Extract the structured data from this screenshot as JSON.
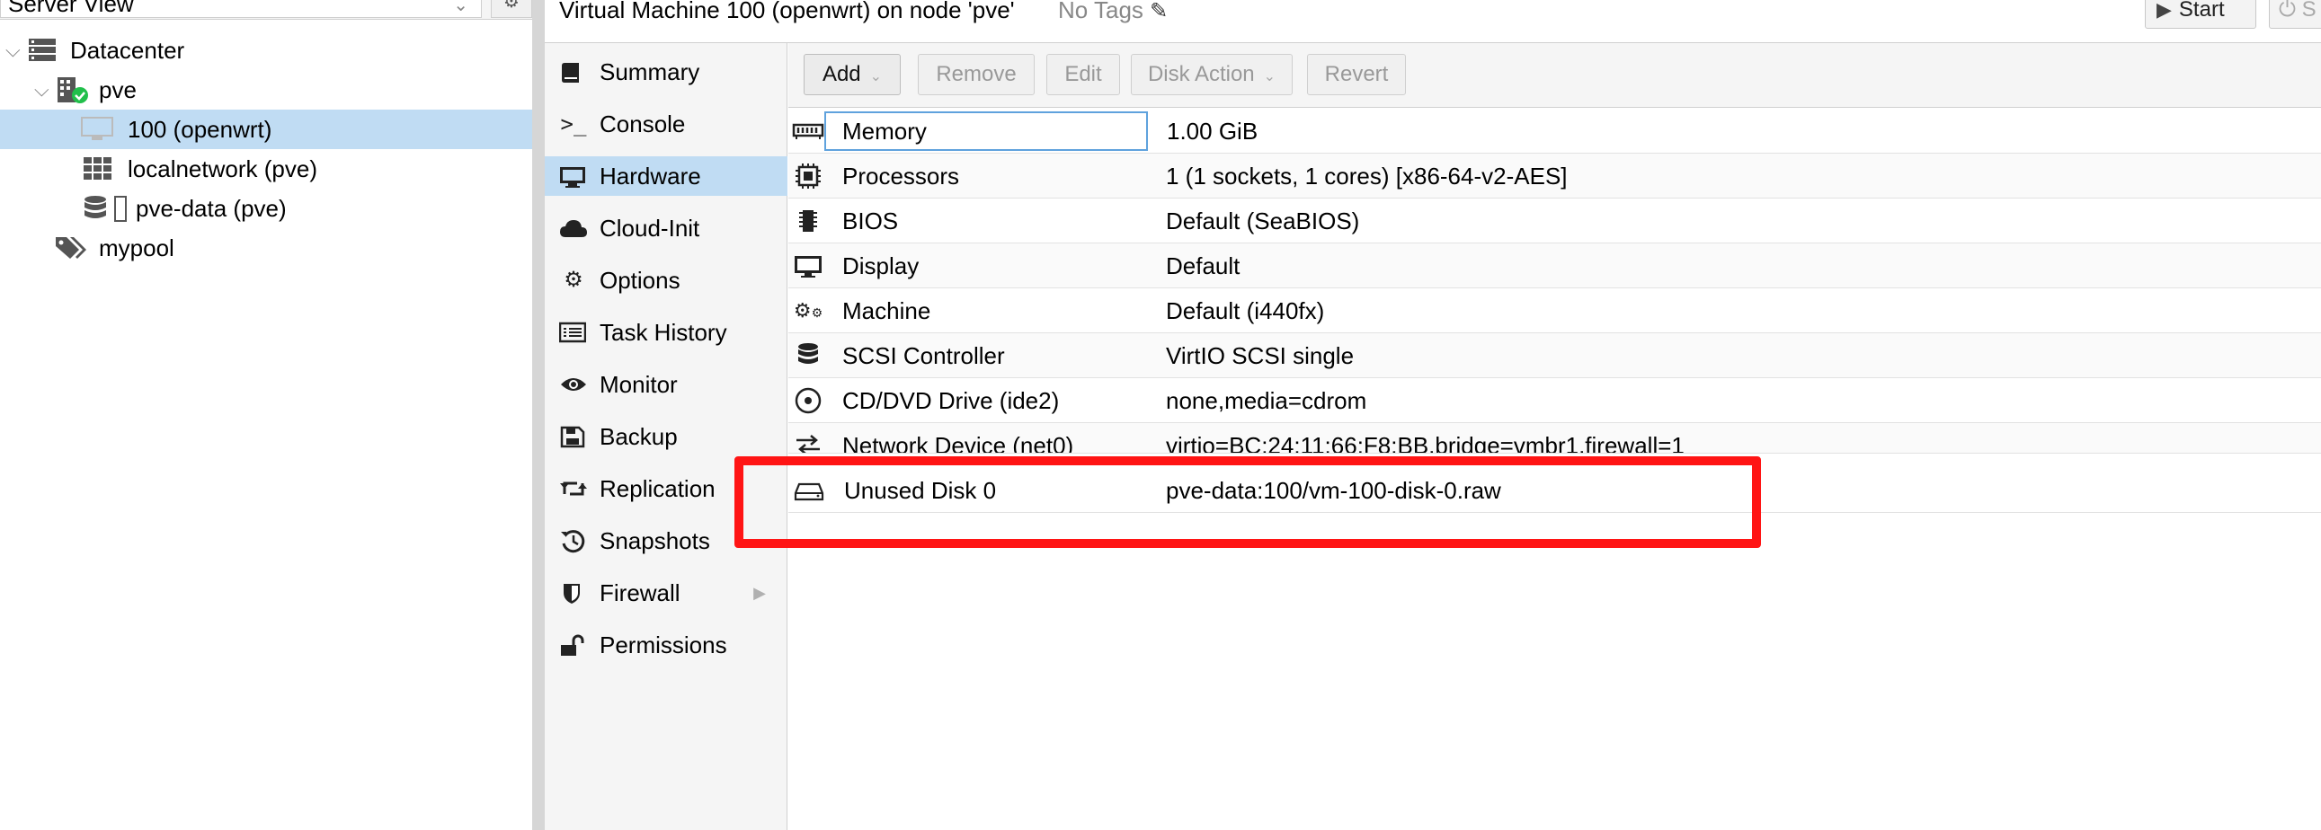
{
  "tree": {
    "view_label": "Server View",
    "items": [
      {
        "label": "Datacenter",
        "icon": "datacenter-icon"
      },
      {
        "label": "pve",
        "icon": "node-online-icon"
      },
      {
        "label": "100 (openwrt)",
        "icon": "vm-icon"
      },
      {
        "label": "localnetwork (pve)",
        "icon": "sdn-zone-icon"
      },
      {
        "label": "pve-data (pve)",
        "icon": "storage-icon"
      },
      {
        "label": "mypool",
        "icon": "pool-tags-icon"
      }
    ]
  },
  "header": {
    "title": "Virtual Machine 100 (openwrt) on node 'pve'",
    "tags": "No Tags",
    "start_label": "Start",
    "shutdown_label": "S"
  },
  "side_menu": {
    "items": [
      {
        "label": "Summary",
        "icon": "book-icon"
      },
      {
        "label": "Console",
        "icon": "terminal-icon"
      },
      {
        "label": "Hardware",
        "icon": "desktop-icon"
      },
      {
        "label": "Cloud-Init",
        "icon": "cloud-icon"
      },
      {
        "label": "Options",
        "icon": "gear-icon"
      },
      {
        "label": "Task History",
        "icon": "list-alt-icon"
      },
      {
        "label": "Monitor",
        "icon": "eye-icon"
      },
      {
        "label": "Backup",
        "icon": "floppy-icon"
      },
      {
        "label": "Replication",
        "icon": "retweet-icon"
      },
      {
        "label": "Snapshots",
        "icon": "history-icon"
      },
      {
        "label": "Firewall",
        "icon": "shield-icon"
      },
      {
        "label": "Permissions",
        "icon": "unlock-icon"
      }
    ],
    "active": "Hardware"
  },
  "toolbar": {
    "add_label": "Add",
    "remove_label": "Remove",
    "edit_label": "Edit",
    "disk_action_label": "Disk Action",
    "revert_label": "Revert"
  },
  "hardware": {
    "rows": [
      {
        "name": "Memory",
        "value": "1.00 GiB",
        "icon": "memory-icon"
      },
      {
        "name": "Processors",
        "value": "1 (1 sockets, 1 cores) [x86-64-v2-AES]",
        "icon": "cpu-icon"
      },
      {
        "name": "BIOS",
        "value": "Default (SeaBIOS)",
        "icon": "microchip-icon"
      },
      {
        "name": "Display",
        "value": "Default",
        "icon": "desktop-icon"
      },
      {
        "name": "Machine",
        "value": "Default (i440fx)",
        "icon": "cogs-icon"
      },
      {
        "name": "SCSI Controller",
        "value": "VirtIO SCSI single",
        "icon": "database-icon"
      },
      {
        "name": "CD/DVD Drive (ide2)",
        "value": "none,media=cdrom",
        "icon": "cdrom-icon"
      },
      {
        "name": "Network Device (net0)",
        "value": "virtio=BC:24:11:66:F8:BB,bridge=vmbr1,firewall=1",
        "icon": "exchange-icon"
      },
      {
        "name": "Unused Disk 0",
        "value": "pve-data:100/vm-100-disk-0.raw",
        "icon": "hdd-icon"
      }
    ]
  },
  "colors": {
    "selection": "#c0dcf3",
    "highlight": "#ff1414",
    "focus_border": "#5fa2dd"
  }
}
